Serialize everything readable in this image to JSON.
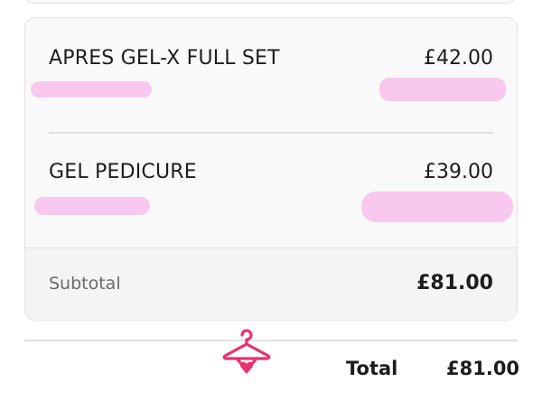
{
  "order_items": [
    {
      "name": "APRES GEL-X FULL SET",
      "price": "£42.00"
    },
    {
      "name": "GEL PEDICURE",
      "price": "£39.00"
    }
  ],
  "subtotal": {
    "label": "Subtotal",
    "value": "£81.00"
  },
  "total": {
    "label": "Total",
    "value": "£81.00"
  },
  "colors": {
    "redaction": "#f8c8ef",
    "logo": "#e8336e"
  },
  "logo_icon": "hanger-heart-icon"
}
